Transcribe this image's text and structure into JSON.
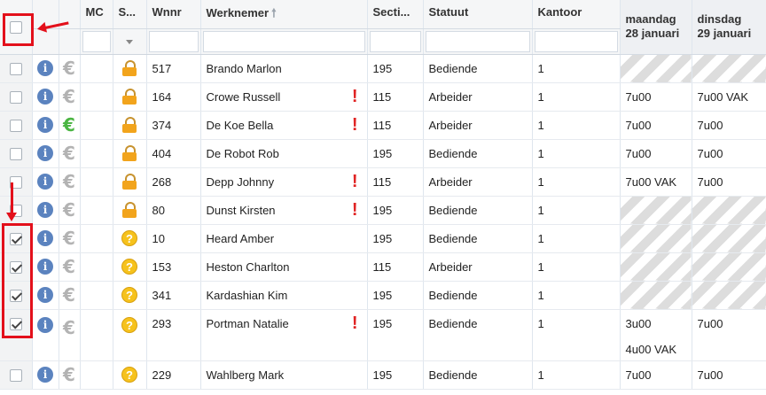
{
  "columns": {
    "mc": "MC",
    "status": "S...",
    "wnnr": "Wnnr",
    "werknemer": "Werknemer",
    "sort_icon": "sort-up-icon",
    "sectie": "Secti...",
    "statuut": "Statuut",
    "kantoor": "Kantoor",
    "day1_line1": "maandag",
    "day1_line2": "28 januari",
    "day2_line1": "dinsdag",
    "day2_line2": "29 januari"
  },
  "rows": [
    {
      "checked": false,
      "euro_green": false,
      "status_icon": "lock",
      "wnnr": "517",
      "name": "Brando Marlon",
      "warn": false,
      "sectie": "195",
      "statuut": "Bediende",
      "kantoor": "1",
      "day1": "",
      "day1_hatched": true,
      "day2": "",
      "day2_hatched": true
    },
    {
      "checked": false,
      "euro_green": false,
      "status_icon": "lock",
      "wnnr": "164",
      "name": "Crowe Russell",
      "warn": true,
      "sectie": "115",
      "statuut": "Arbeider",
      "kantoor": "1",
      "day1": "7u00",
      "day1_hatched": false,
      "day2": "7u00 VAK",
      "day2_hatched": false
    },
    {
      "checked": false,
      "euro_green": true,
      "status_icon": "lock",
      "wnnr": "374",
      "name": "De Koe Bella",
      "warn": true,
      "sectie": "115",
      "statuut": "Arbeider",
      "kantoor": "1",
      "day1": "7u00",
      "day1_hatched": false,
      "day2": "7u00",
      "day2_hatched": false
    },
    {
      "checked": false,
      "euro_green": false,
      "status_icon": "lock",
      "wnnr": "404",
      "name": "De Robot Rob",
      "warn": false,
      "sectie": "195",
      "statuut": "Bediende",
      "kantoor": "1",
      "day1": "7u00",
      "day1_hatched": false,
      "day2": "7u00",
      "day2_hatched": false
    },
    {
      "checked": false,
      "euro_green": false,
      "status_icon": "lock",
      "wnnr": "268",
      "name": "Depp Johnny",
      "warn": true,
      "sectie": "115",
      "statuut": "Arbeider",
      "kantoor": "1",
      "day1": "7u00 VAK",
      "day1_hatched": false,
      "day2": "7u00",
      "day2_hatched": false
    },
    {
      "checked": false,
      "euro_green": false,
      "status_icon": "lock",
      "wnnr": "80",
      "name": "Dunst Kirsten",
      "warn": true,
      "sectie": "195",
      "statuut": "Bediende",
      "kantoor": "1",
      "day1": "",
      "day1_hatched": true,
      "day2": "",
      "day2_hatched": true
    },
    {
      "checked": true,
      "euro_green": false,
      "status_icon": "question",
      "wnnr": "10",
      "name": "Heard Amber",
      "warn": false,
      "sectie": "195",
      "statuut": "Bediende",
      "kantoor": "1",
      "day1": "",
      "day1_hatched": true,
      "day2": "",
      "day2_hatched": true
    },
    {
      "checked": true,
      "euro_green": false,
      "status_icon": "question",
      "wnnr": "153",
      "name": "Heston Charlton",
      "warn": false,
      "sectie": "115",
      "statuut": "Arbeider",
      "kantoor": "1",
      "day1": "",
      "day1_hatched": true,
      "day2": "",
      "day2_hatched": true
    },
    {
      "checked": true,
      "euro_green": false,
      "status_icon": "question",
      "wnnr": "341",
      "name": "Kardashian Kim",
      "warn": false,
      "sectie": "195",
      "statuut": "Bediende",
      "kantoor": "1",
      "day1": "",
      "day1_hatched": true,
      "day2": "",
      "day2_hatched": true
    },
    {
      "checked": true,
      "euro_green": false,
      "status_icon": "question",
      "wnnr": "293",
      "name": "Portman Natalie",
      "warn": true,
      "sectie": "195",
      "statuut": "Bediende",
      "kantoor": "1",
      "day1": "3u00",
      "day1_line2": "4u00 VAK",
      "day1_hatched": false,
      "day2": "7u00",
      "day2_hatched": false,
      "tall": true
    },
    {
      "checked": false,
      "euro_green": false,
      "status_icon": "question",
      "wnnr": "229",
      "name": "Wahlberg Mark",
      "warn": false,
      "sectie": "195",
      "statuut": "Bediende",
      "kantoor": "1",
      "day1": "7u00",
      "day1_hatched": false,
      "day2": "7u00",
      "day2_hatched": false
    }
  ],
  "glyphs": {
    "info": "i",
    "euro": "€",
    "question": "?",
    "warn": "!"
  },
  "colors": {
    "annotation": "#e3101b",
    "info": "#5b83bf",
    "euro_green": "#4bb543",
    "lock": "#f2a41c",
    "question": "#f6c21c",
    "warn": "#e02424"
  }
}
